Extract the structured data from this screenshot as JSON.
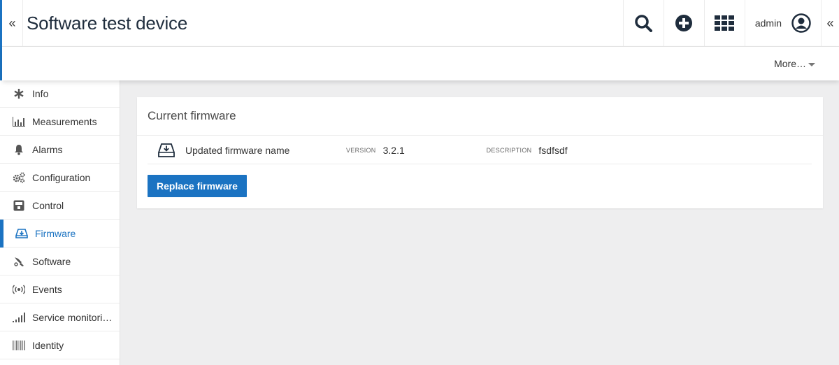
{
  "header": {
    "title": "Software test device",
    "user_name": "admin",
    "collapse_left_glyph": "«",
    "collapse_right_glyph": "«",
    "icons": [
      "search-icon",
      "add-circle-icon",
      "apps-grid-icon",
      "user-avatar-icon"
    ]
  },
  "subheader": {
    "more_label": "More…"
  },
  "sidebar": {
    "items": [
      {
        "label": "Info",
        "icon": "asterisk-icon"
      },
      {
        "label": "Measurements",
        "icon": "bar-chart-icon"
      },
      {
        "label": "Alarms",
        "icon": "bell-icon"
      },
      {
        "label": "Configuration",
        "icon": "cogs-icon"
      },
      {
        "label": "Control",
        "icon": "control-icon"
      },
      {
        "label": "Firmware",
        "icon": "firmware-icon",
        "active": true
      },
      {
        "label": "Software",
        "icon": "software-icon"
      },
      {
        "label": "Events",
        "icon": "broadcast-icon"
      },
      {
        "label": "Service monitori…",
        "icon": "signal-icon"
      },
      {
        "label": "Identity",
        "icon": "barcode-icon"
      }
    ]
  },
  "card": {
    "title": "Current firmware",
    "firmware_name": "Updated firmware name",
    "version_label": "VERSION",
    "version_value": "3.2.1",
    "description_label": "DESCRIPTION",
    "description_value": "fsdfsdf",
    "replace_button": "Replace firmware"
  },
  "colors": {
    "accent": "#1b73c2",
    "background": "#eeeeef",
    "header_icon": "#1f2d3d"
  }
}
